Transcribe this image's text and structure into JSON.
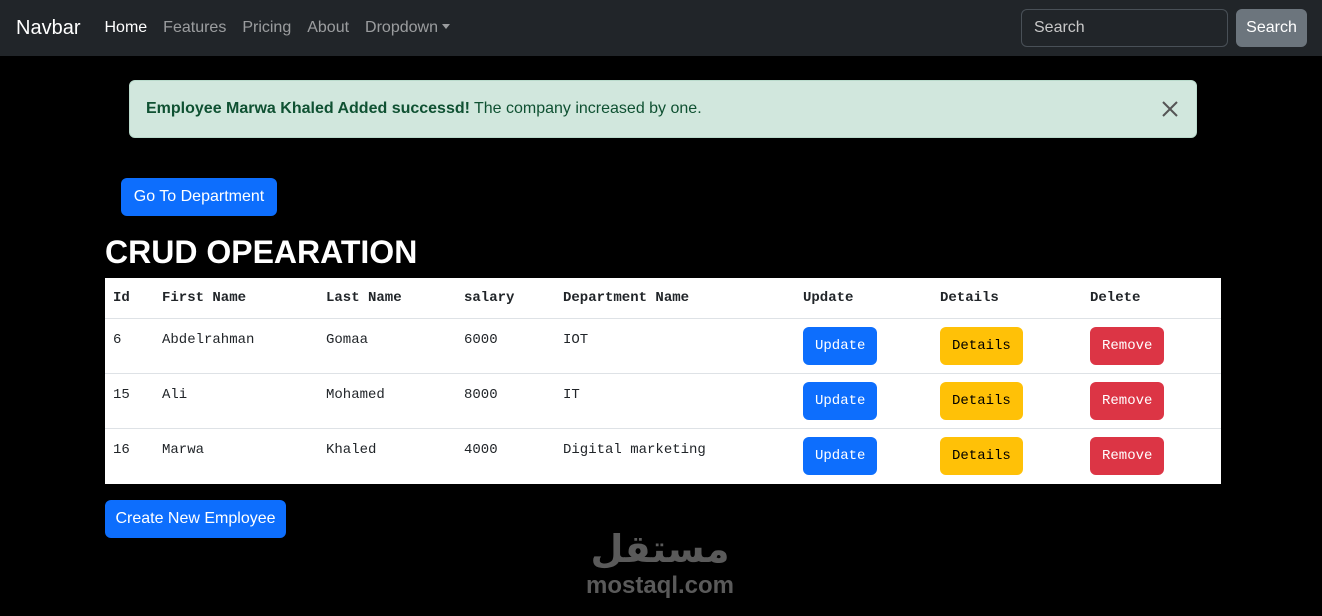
{
  "navbar": {
    "brand": "Navbar",
    "links": [
      "Home",
      "Features",
      "Pricing",
      "About",
      "Dropdown"
    ],
    "search_placeholder": "Search",
    "search_button": "Search"
  },
  "alert": {
    "strong": "Employee Marwa Khaled Added successd!",
    "text": "The company increased by one."
  },
  "go_department_label": "Go To Department",
  "heading": "CRUD OPEARATION",
  "table": {
    "headers": [
      "Id",
      "First Name",
      "Last Name",
      "salary",
      "Department Name",
      "Update",
      "Details",
      "Delete"
    ],
    "rows": [
      {
        "id": "6",
        "first": "Abdelrahman",
        "last": "Gomaa",
        "salary": "6000",
        "dept": "IOT"
      },
      {
        "id": "15",
        "first": "Ali",
        "last": "Mohamed",
        "salary": "8000",
        "dept": "IT"
      },
      {
        "id": "16",
        "first": "Marwa",
        "last": "Khaled",
        "salary": "4000",
        "dept": "Digital marketing"
      }
    ],
    "update_label": "Update",
    "details_label": "Details",
    "remove_label": "Remove"
  },
  "create_label": "Create New Employee",
  "watermark": {
    "arabic": "مستقل",
    "latin": "mostaql.com"
  },
  "colors": {
    "primary": "#0d6efd",
    "warning": "#ffc107",
    "danger": "#dc3545",
    "alert_bg": "#d1e7dd"
  }
}
